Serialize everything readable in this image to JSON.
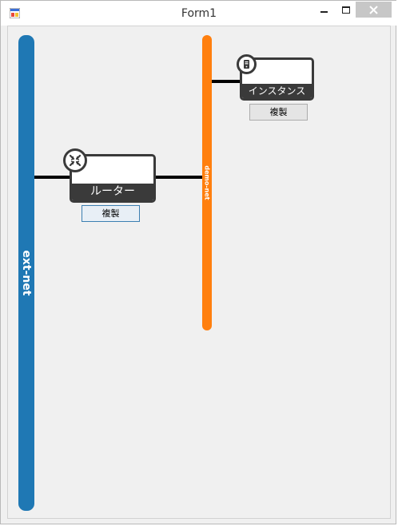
{
  "window": {
    "title": "Form1",
    "icons": {
      "app": "app-form-icon",
      "minimize": "minimize-icon",
      "maximize": "maximize-icon",
      "close": "close-icon"
    }
  },
  "networks": [
    {
      "name": "ext-net",
      "color": "#1f78b4"
    },
    {
      "name": "demo-net",
      "color": "#ff7f0e"
    }
  ],
  "nodes": {
    "router": {
      "label": "ルーター",
      "icon": "router-icon",
      "duplicate_label": "複製"
    },
    "instance": {
      "label": "インスタンス",
      "icon": "server-icon",
      "duplicate_label": "複製"
    }
  }
}
